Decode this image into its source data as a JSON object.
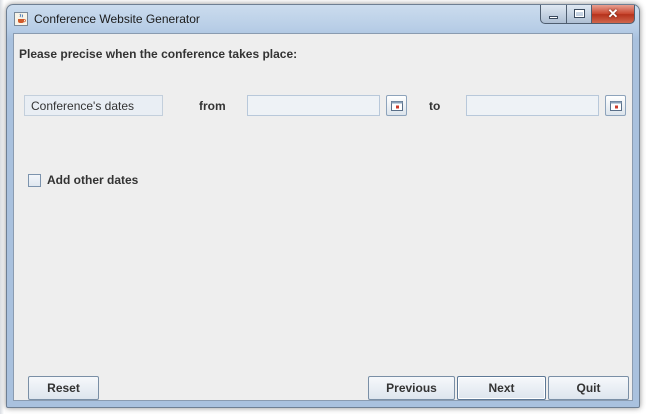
{
  "window": {
    "title": "Conference Website Generator",
    "close_glyph": "✕",
    "icons": {
      "app": "java-cup-icon",
      "minimize": "minimize-icon",
      "maximize": "maximize-icon",
      "close": "close-icon"
    }
  },
  "form": {
    "prompt": "Please precise when the conference takes place:",
    "dates_label": "Conference's dates",
    "from_label": "from",
    "to_label": "to",
    "from_value": "",
    "to_value": "",
    "calendar_icon": "calendar-icon",
    "add_other_dates_label": "Add other dates",
    "add_other_dates_checked": false
  },
  "buttons": {
    "reset": "Reset",
    "previous": "Previous",
    "next": "Next",
    "quit": "Quit"
  }
}
